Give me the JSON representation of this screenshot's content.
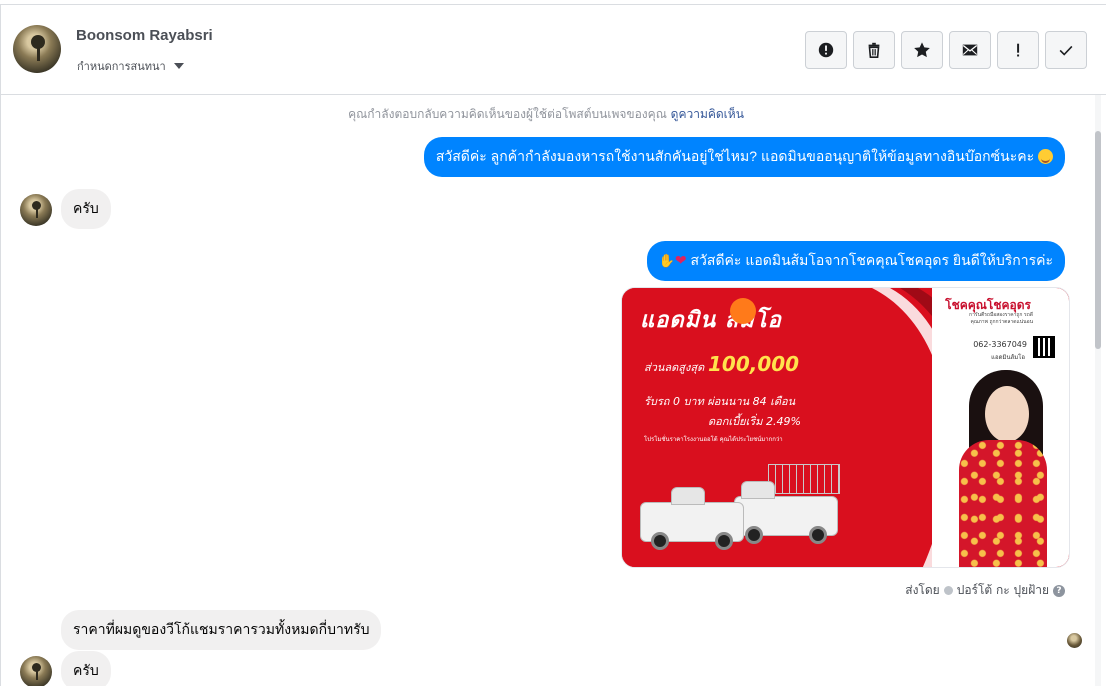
{
  "header": {
    "user_name": "Boonsom Rayabsri",
    "assign_label": "กำหนดการสนทนา",
    "actions": [
      {
        "name": "report-spam-icon",
        "label": "!"
      },
      {
        "name": "trash-icon",
        "label": ""
      },
      {
        "name": "star-icon",
        "label": ""
      },
      {
        "name": "mail-icon",
        "label": ""
      },
      {
        "name": "exclamation-icon",
        "label": "!"
      },
      {
        "name": "check-icon",
        "label": ""
      }
    ]
  },
  "conversation": {
    "reply_note": "คุณกำลังตอบกลับความคิดเห็นของผู้ใช้ต่อโพสต์บนเพจของคุณ",
    "reply_note_link": "ดูความคิดเห็น",
    "messages": [
      {
        "direction": "out",
        "text": "สวัสดีค่ะ ลูกค้ากำลังมองหารถใช้งานสักคันอยู่ใช่ไหม? แอดมินขออนุญาติให้ข้อมูลทางอินบ๊อกซ์นะคะ"
      },
      {
        "direction": "in",
        "text": "ครับ"
      },
      {
        "direction": "out",
        "text": "สวัสดีค่ะ แอดมินส้มโอจากโชคคุณโชคอุดร ยินดีให้บริการค่ะ"
      },
      {
        "direction": "in",
        "text": "ราคาที่ผมดูของวีโก้แชมราคารวมทั้งหมดกี่บาทรับ"
      },
      {
        "direction": "in",
        "text": "ครับ"
      }
    ],
    "promo": {
      "title": "แอดมิน  ส้มโอ",
      "line1": "ส่วนลดสูงสุด",
      "amount": "100,000",
      "line2": "รับรถ 0 บาท ผ่อนนาน 84 เดือน",
      "line3": "ดอกเบี้ยเริ่ม 2.49%",
      "line4": "โปรโมชั่นราคาโรงงานออโต้ คุณได้ประโยชน์มากกว่า",
      "brand": "โชคคุณโชคอุดร",
      "brand_sub": "การันตีรถมือสองราคาถูก รถดี คุณภาพ ถูกกว่าตลาดแน่นอน",
      "phone": "062-3367049",
      "admin": "แอดมินส้มโอ"
    },
    "sent_by_label": "ส่งโดย",
    "sent_by_agent": "ปอร์โต้ กะ ปุยฝ้าย"
  },
  "colors": {
    "accent": "#0084ff",
    "incoming_bubble": "#f1f0f0",
    "promo_red": "#d90f1e"
  }
}
